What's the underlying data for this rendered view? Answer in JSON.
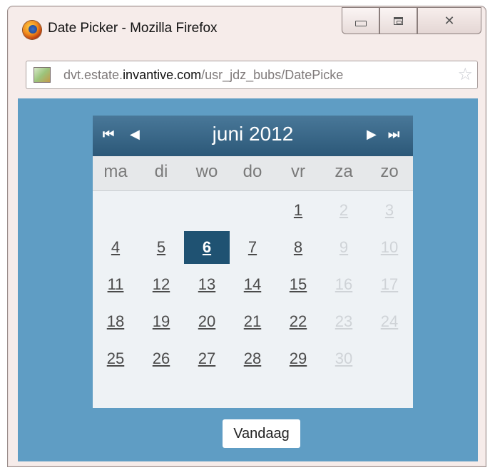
{
  "window": {
    "title": "Date Picker - Mozilla Firefox",
    "minimize_glyph": "minimize-icon",
    "maximize_glyph": "maximize-icon",
    "close_glyph": "close-icon"
  },
  "urlbar": {
    "prefix": "dvt.estate.",
    "domain": "invantive.com",
    "path": "/usr_jdz_bubs/DatePicke",
    "site_icon": "site-favicon-icon",
    "bookmark_icon": "star-icon"
  },
  "calendar": {
    "month_title": "juni 2012",
    "nav": {
      "first": "⏮",
      "prev": "◀",
      "next": "▶",
      "last": "⏭"
    },
    "weekdays": [
      "ma",
      "di",
      "wo",
      "do",
      "vr",
      "za",
      "zo"
    ],
    "selected_day": "6",
    "weeks": [
      [
        "",
        "",
        "",
        "",
        "1",
        "2",
        "3"
      ],
      [
        "4",
        "5",
        "6",
        "7",
        "8",
        "9",
        "10"
      ],
      [
        "11",
        "12",
        "13",
        "14",
        "15",
        "16",
        "17"
      ],
      [
        "18",
        "19",
        "20",
        "21",
        "22",
        "23",
        "24"
      ],
      [
        "25",
        "26",
        "27",
        "28",
        "29",
        "30",
        ""
      ]
    ],
    "today_button": "Vandaag"
  },
  "colors": {
    "content_bg": "#5f9dc4",
    "header_bg": "#2c5878",
    "selected_bg": "#1f5272"
  }
}
